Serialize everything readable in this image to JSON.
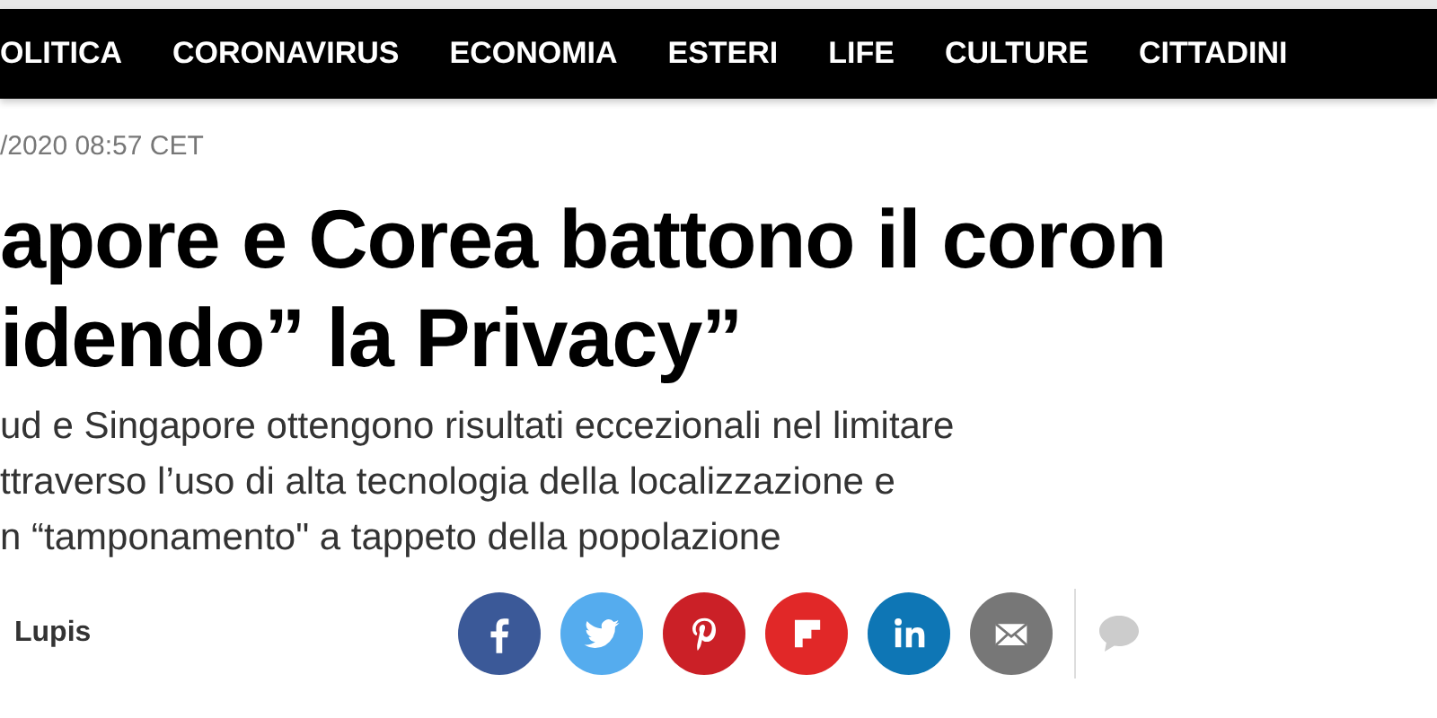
{
  "nav": {
    "items": [
      "OLITICA",
      "CORONAVIRUS",
      "ECONOMIA",
      "ESTERI",
      "LIFE",
      "CULTURE",
      "CITTADINI"
    ]
  },
  "article": {
    "date": "/2020 08:57 CET",
    "headline": [
      "apore e Corea battono il coron",
      "idendo” la Privacy”"
    ],
    "subtitle": [
      "ud e Singapore ottengono risultati eccezionali nel limitare",
      "ttraverso l’uso di alta tecnologia della localizzazione e",
      "n “tamponamento\" a tappeto della popolazione"
    ],
    "author": "Lupis",
    "share": [
      {
        "kind": "facebook",
        "color": "#3b5998"
      },
      {
        "kind": "twitter",
        "color": "#55acee"
      },
      {
        "kind": "pinterest",
        "color": "#cb2027"
      },
      {
        "kind": "flipboard",
        "color": "#e12828"
      },
      {
        "kind": "linkedin",
        "color": "#0e76b5"
      },
      {
        "kind": "email",
        "color": "#777777"
      }
    ]
  }
}
